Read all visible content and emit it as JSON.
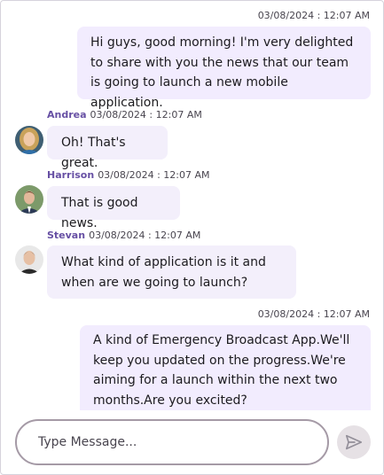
{
  "messages": [
    {
      "type": "outgoing",
      "timestamp": "03/08/2024 : 12:07 AM",
      "text": "Hi guys, good morning! I'm very delighted to share with you the news that our team is going to launch a new mobile application."
    },
    {
      "type": "incoming",
      "author": "Andrea",
      "timestamp": "03/08/2024 : 12:07 AM",
      "text": "Oh! That's great.",
      "avatar": "woman-avatar"
    },
    {
      "type": "incoming",
      "author": "Harrison",
      "timestamp": "03/08/2024 : 12:07 AM",
      "text": "That is good news.",
      "avatar": "man-suit-avatar"
    },
    {
      "type": "incoming",
      "author": "Stevan",
      "timestamp": "03/08/2024 : 12:07 AM",
      "text": "What kind of application is it and when are we going to launch?",
      "avatar": "man-avatar"
    },
    {
      "type": "outgoing",
      "timestamp": "03/08/2024 : 12:07 AM",
      "text": "A kind of Emergency Broadcast App.We'll keep you updated on the progress.We're aiming for a launch within the next two months.Are you excited?"
    }
  ],
  "composer": {
    "placeholder": "Type Message...",
    "value": ""
  },
  "send": {
    "icon": "send-icon",
    "bg": "#e6e1e5",
    "icon_color": "#938f99"
  },
  "colors": {
    "author": "#6750a4",
    "bubble": "#f3effb",
    "border": "#d6d3dc"
  }
}
